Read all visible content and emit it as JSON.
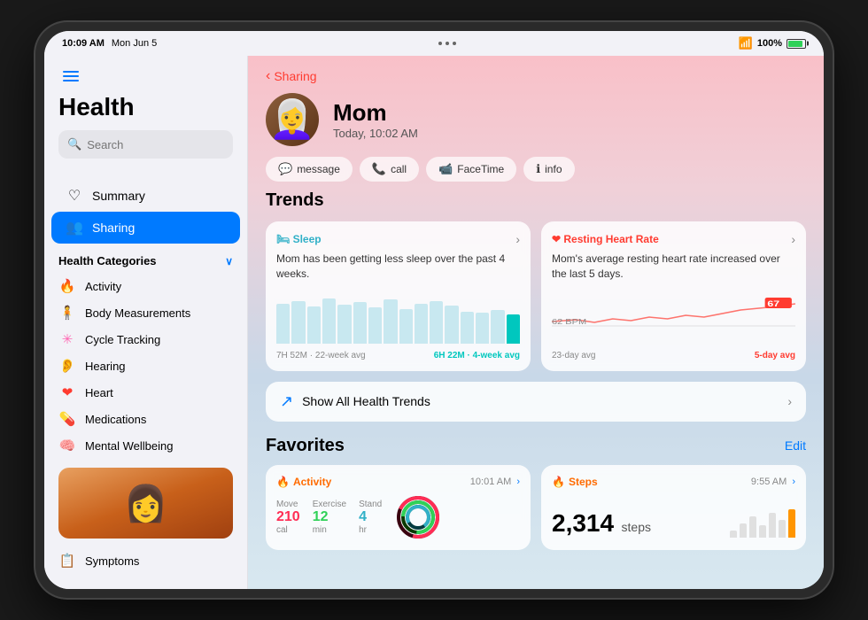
{
  "statusBar": {
    "time": "10:09 AM",
    "date": "Mon Jun 5",
    "battery": "100%",
    "batteryColor": "#30d158"
  },
  "sidebar": {
    "appTitle": "Health",
    "search": {
      "placeholder": "Search"
    },
    "navItems": [
      {
        "id": "summary",
        "label": "Summary",
        "icon": "♡"
      },
      {
        "id": "sharing",
        "label": "Sharing",
        "icon": "👥",
        "active": true
      }
    ],
    "healthCategories": {
      "title": "Health Categories",
      "items": [
        {
          "id": "activity",
          "label": "Activity",
          "icon": "🔥",
          "color": "#ff6b00"
        },
        {
          "id": "body-measurements",
          "label": "Body Measurements",
          "icon": "🧍",
          "color": "#555"
        },
        {
          "id": "cycle-tracking",
          "label": "Cycle Tracking",
          "icon": "✳",
          "color": "#ff69b4"
        },
        {
          "id": "hearing",
          "label": "Hearing",
          "icon": "👂",
          "color": "#6b48ff"
        },
        {
          "id": "heart",
          "label": "Heart",
          "icon": "❤",
          "color": "#ff3b30"
        },
        {
          "id": "medications",
          "label": "Medications",
          "icon": "💊",
          "color": "#34aadc"
        },
        {
          "id": "mental-wellbeing",
          "label": "Mental Wellbeing",
          "icon": "🧠",
          "color": "#30b0c7"
        }
      ]
    },
    "symptoms": {
      "label": "Symptoms",
      "icon": "📋"
    }
  },
  "mainContent": {
    "backLabel": "Sharing",
    "profile": {
      "name": "Mom",
      "time": "Today, 10:02 AM",
      "avatar": "👩"
    },
    "actionButtons": [
      {
        "id": "message",
        "label": "message",
        "icon": "💬"
      },
      {
        "id": "call",
        "label": "call",
        "icon": "📞"
      },
      {
        "id": "facetime",
        "label": "FaceTime",
        "icon": "📹"
      },
      {
        "id": "info",
        "label": "info",
        "icon": "ℹ"
      }
    ],
    "trends": {
      "title": "Trends",
      "cards": [
        {
          "id": "sleep",
          "label": "Sleep",
          "color": "#30b0c7",
          "description": "Mom has been getting less sleep over the past 4 weeks.",
          "chartLabel1": "22-week avg",
          "chartLabel2": "4-week avg",
          "highlight": "6H 22M",
          "baseline": "7H 52M"
        },
        {
          "id": "resting-heart-rate",
          "label": "Resting Heart Rate",
          "color": "#ff3b30",
          "description": "Mom's average resting heart rate increased over the last 5 days.",
          "chartLabel1": "23-day avg",
          "chartLabel2": "5-day avg",
          "highlight": "67",
          "baseline": "62 BPM"
        }
      ],
      "showAllLabel": "Show All Health Trends"
    },
    "favorites": {
      "title": "Favorites",
      "editLabel": "Edit",
      "cards": [
        {
          "id": "activity",
          "label": "Activity",
          "icon": "🔥",
          "time": "10:01 AM",
          "stats": [
            {
              "label": "Move",
              "value": "210",
              "unit": "cal"
            },
            {
              "label": "Exercise",
              "value": "12",
              "unit": "min"
            },
            {
              "label": "Stand",
              "value": "4",
              "unit": "hr"
            }
          ]
        },
        {
          "id": "steps",
          "label": "Steps",
          "icon": "🔥",
          "time": "9:55 AM",
          "value": "2,314",
          "unit": "steps"
        }
      ]
    }
  }
}
